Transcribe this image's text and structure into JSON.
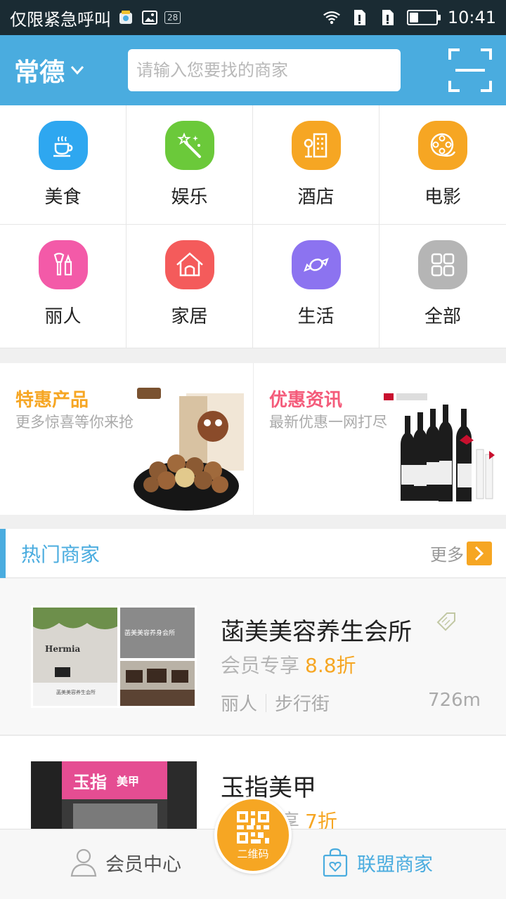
{
  "status_bar": {
    "carrier": "仅限紧急呼叫",
    "badge": "28",
    "time": "10:41",
    "battery_level": 0.33
  },
  "header": {
    "city": "常德",
    "search_placeholder": "请输入您要找的商家"
  },
  "categories": [
    {
      "label": "美食",
      "icon": "coffee-cup-icon",
      "color": "#2ea7f0"
    },
    {
      "label": "娱乐",
      "icon": "magic-wand-icon",
      "color": "#6bc93a"
    },
    {
      "label": "酒店",
      "icon": "hotel-building-icon",
      "color": "#f6a623"
    },
    {
      "label": "电影",
      "icon": "film-reel-icon",
      "color": "#f6a623"
    },
    {
      "label": "丽人",
      "icon": "makeup-icon",
      "color": "#f35aa8"
    },
    {
      "label": "家居",
      "icon": "house-icon",
      "color": "#f45b5b"
    },
    {
      "label": "生活",
      "icon": "candy-icon",
      "color": "#8c73f0"
    },
    {
      "label": "全部",
      "icon": "grid-icon",
      "color": "#b5b5b5"
    }
  ],
  "promos": [
    {
      "title": "特惠产品",
      "subtitle": "更多惊喜等你来抢",
      "title_color": "#f6a623"
    },
    {
      "title": "优惠资讯",
      "subtitle": "最新优惠一网打尽",
      "title_color": "#f45b7a"
    }
  ],
  "hot_section": {
    "title": "热门商家",
    "more": "更多"
  },
  "merchants": [
    {
      "name": "菡美美容养生会所",
      "member_text": "会员专享",
      "discount": "8.8折",
      "category": "丽人",
      "area": "步行街",
      "distance": "726m",
      "image_sign": "Hermia",
      "image_caption": "菡美美容养身会所",
      "image_desk_text": "菡美美容养生会所"
    },
    {
      "name": "玉指美甲",
      "member_text": "会员专享",
      "discount": "7折",
      "image_sign_1": "玉指",
      "image_sign_2": "美甲"
    }
  ],
  "bottom_nav": {
    "left_label": "会员中心",
    "center_label": "二维码",
    "right_label": "联盟商家",
    "active_color": "#4aacdf",
    "inactive_color": "#555555"
  }
}
